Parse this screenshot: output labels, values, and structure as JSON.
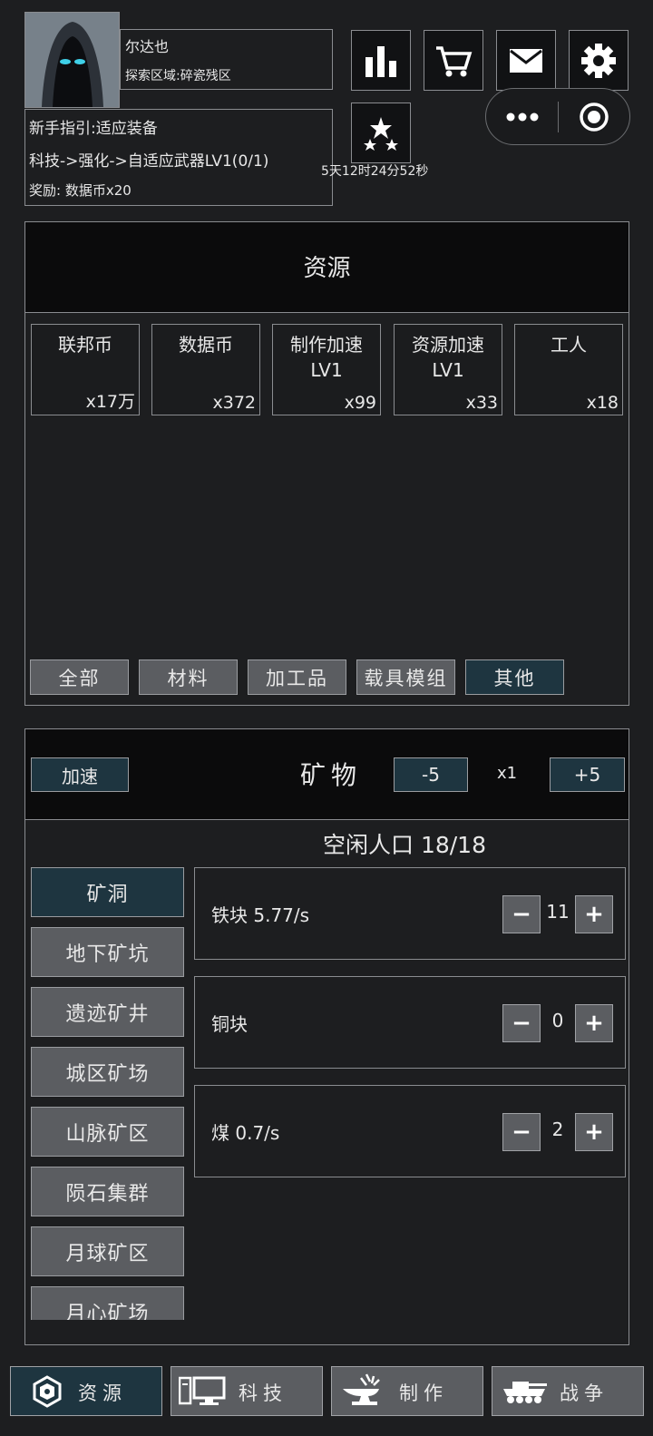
{
  "player": {
    "name": "尔达也",
    "zone": "探索区域:碎瓷残区"
  },
  "guide": {
    "title": "新手指引:适应装备",
    "task": "科技->强化->自适应武器LV1(0/1)",
    "reward": "奖励: 数据币x20"
  },
  "toolbar": {
    "icons": [
      "stats-icon",
      "cart-icon",
      "mail-icon",
      "gear-icon",
      "star-icon"
    ],
    "timer": "5天12时24分52秒"
  },
  "capsule": {
    "icons": [
      "more-icon",
      "record-icon"
    ]
  },
  "resources_panel": {
    "title": "资源",
    "cards": [
      {
        "name": "联邦币",
        "count": "x17万"
      },
      {
        "name": "数据币",
        "count": "x372"
      },
      {
        "name": "制作加速\nLV1",
        "count": "x99"
      },
      {
        "name": "资源加速\nLV1",
        "count": "x33"
      },
      {
        "name": "工人",
        "count": "x18"
      }
    ],
    "filters": [
      {
        "label": "全部",
        "active": false
      },
      {
        "label": "材料",
        "active": false
      },
      {
        "label": "加工品",
        "active": false
      },
      {
        "label": "载具模组",
        "active": false
      },
      {
        "label": "其他",
        "active": true
      }
    ]
  },
  "mining_panel": {
    "speedup_label": "加速",
    "title": "矿物",
    "minus_label": "-5",
    "multiplier": "x1",
    "plus_label": "+5",
    "idle_population": "空闲人口 18/18",
    "locations": [
      {
        "label": "矿洞",
        "active": true
      },
      {
        "label": "地下矿坑",
        "active": false
      },
      {
        "label": "遗迹矿井",
        "active": false
      },
      {
        "label": "城区矿场",
        "active": false
      },
      {
        "label": "山脉矿区",
        "active": false
      },
      {
        "label": "陨石集群",
        "active": false
      },
      {
        "label": "月球矿区",
        "active": false
      },
      {
        "label": "月心矿场",
        "active": false
      }
    ],
    "ores": [
      {
        "name": "铁块 5.77/s",
        "workers": "11"
      },
      {
        "name": "铜块",
        "workers": "0"
      },
      {
        "name": "煤 0.7/s",
        "workers": "2"
      }
    ],
    "step_minus": "−",
    "step_plus": "+"
  },
  "bottom_nav": [
    {
      "label": "资源",
      "icon": "ore-icon",
      "active": true
    },
    {
      "label": "科技",
      "icon": "computer-icon",
      "active": false
    },
    {
      "label": "制作",
      "icon": "anvil-icon",
      "active": false
    },
    {
      "label": "战争",
      "icon": "tank-icon",
      "active": false
    }
  ],
  "colors": {
    "background": "#1d1e20",
    "accent": "#1e3540",
    "button": "#5b5d61",
    "border": "#8a8c90"
  }
}
